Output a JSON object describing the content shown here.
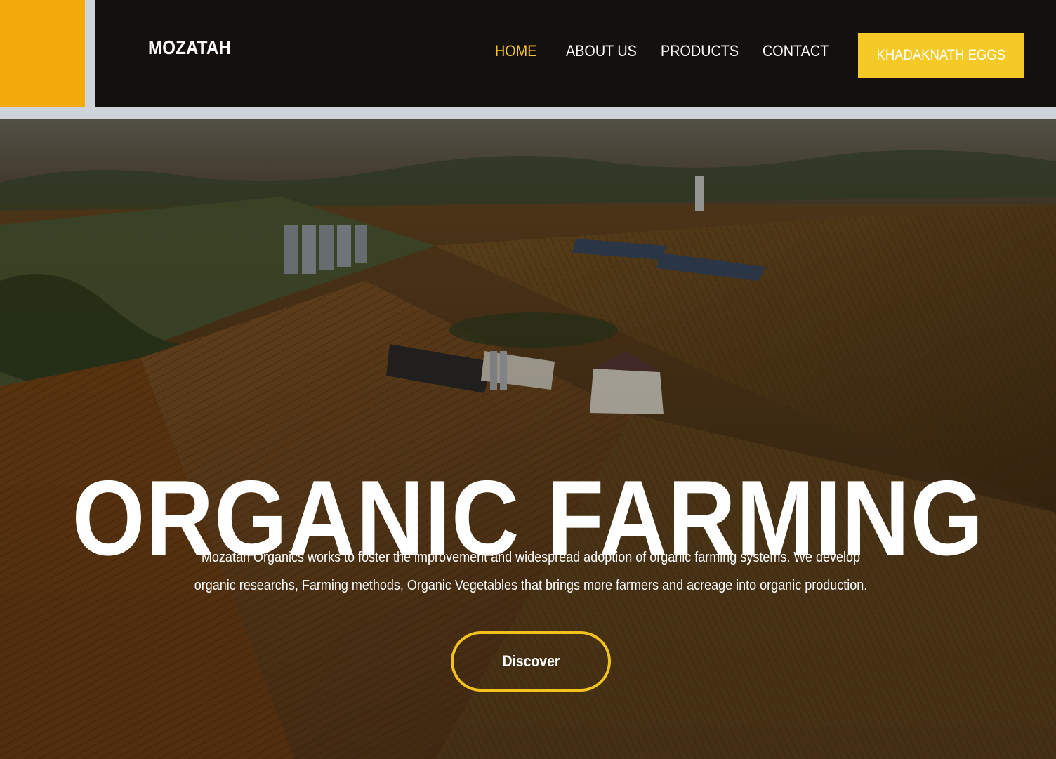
{
  "header": {
    "brand": "MOZATAH",
    "nav": [
      {
        "label": "HOME",
        "active": true
      },
      {
        "label": "ABOUT US",
        "active": false
      },
      {
        "label": "PRODUCTS",
        "active": false
      },
      {
        "label": "CONTACT",
        "active": false
      }
    ],
    "cta_label": "KHADAKNATH EGGS"
  },
  "hero": {
    "title": "ORGANIC FARMING",
    "description": "Mozatah Organics works to foster the improvement and widespread adoption of organic farming systems. We develop organic researchs, Farming methods, Organic Vegetables that brings more farmers and acreage into organic production.",
    "button_label": "Discover"
  },
  "colors": {
    "accent_yellow": "#f5c926",
    "corner_block": "#f2ab0b",
    "nav_background": "#13100d",
    "active_link": "#f5c426"
  }
}
